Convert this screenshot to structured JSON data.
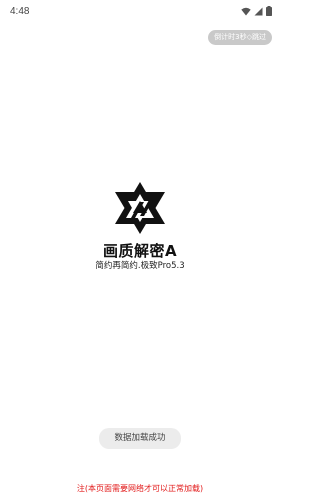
{
  "status_bar": {
    "time": "4:48",
    "icons": [
      "wifi-icon",
      "signal-icon",
      "battery-icon"
    ]
  },
  "countdown_button": {
    "label": "倒计时3秒◇跳过"
  },
  "app": {
    "logo_icon": "triangle-logo-icon",
    "title": "画质解密A",
    "subtitle": "简约再简约.极致Pro5.3"
  },
  "toast": {
    "message": "数据加载成功"
  },
  "notice": {
    "text": "注(本页面需要网络才可以正常加载)",
    "color": "#e21818"
  }
}
